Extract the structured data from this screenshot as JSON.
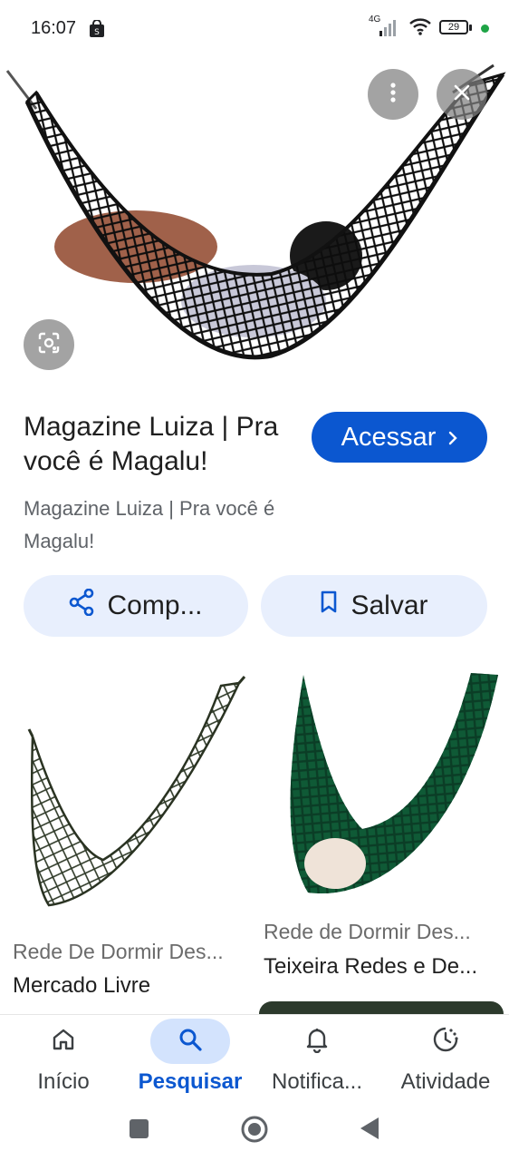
{
  "status_bar": {
    "time": "16:07",
    "network": "4G",
    "battery": "29"
  },
  "hero": {
    "more_icon": "more-vert-icon",
    "close_icon": "close-icon",
    "lens_icon": "lens-icon"
  },
  "result": {
    "title": "Magazine Luiza | Pra você é Magalu!",
    "source": "Magazine Luiza | Pra você é Magalu!",
    "visit_label": "Acessar",
    "share_label": "Comp...",
    "save_label": "Salvar"
  },
  "related": [
    {
      "title": "Rede De Dormir Des...",
      "site": "Mercado Livre"
    },
    {
      "title": "Rede de Dormir Des...",
      "site": "Teixeira Redes e De..."
    }
  ],
  "bottom_nav": [
    {
      "label": "Início",
      "icon": "home-icon"
    },
    {
      "label": "Pesquisar",
      "icon": "search-icon",
      "active": true
    },
    {
      "label": "Notifica...",
      "icon": "bell-icon"
    },
    {
      "label": "Atividade",
      "icon": "activity-icon"
    }
  ],
  "colors": {
    "accent": "#0b57d0",
    "pill_bg": "#e8effd",
    "active_nav_bg": "#d3e3fd"
  }
}
